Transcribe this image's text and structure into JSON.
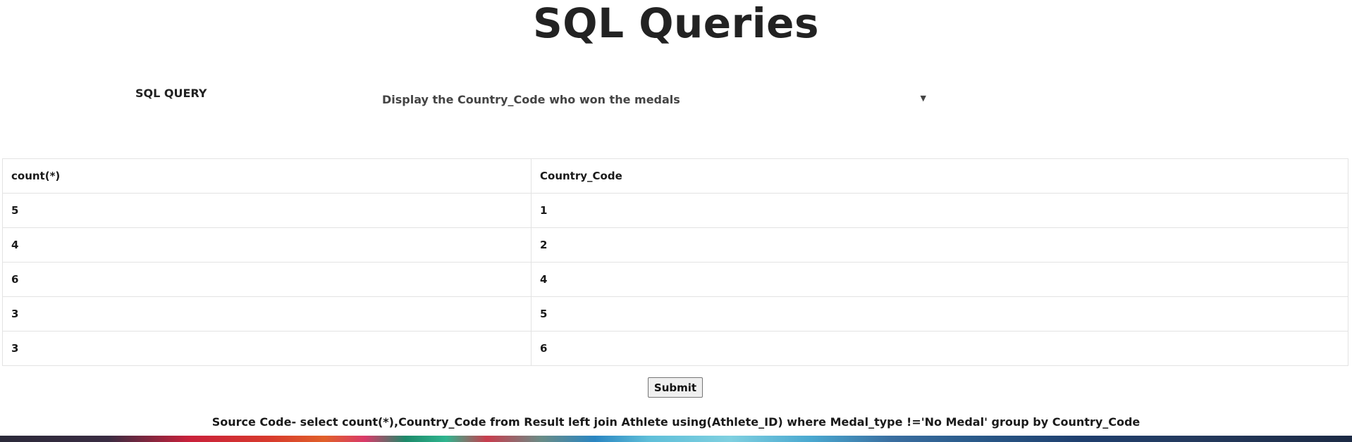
{
  "page": {
    "title": "SQL Queries"
  },
  "query": {
    "label": "SQL QUERY",
    "selected": "Display the Country_Code who won the medals"
  },
  "table": {
    "headers": [
      "count(*)",
      "Country_Code"
    ],
    "rows": [
      [
        "5",
        "1"
      ],
      [
        "4",
        "2"
      ],
      [
        "6",
        "4"
      ],
      [
        "3",
        "5"
      ],
      [
        "3",
        "6"
      ]
    ]
  },
  "actions": {
    "submit_label": "Submit"
  },
  "source": {
    "text": "Source Code- select count(*),Country_Code from Result left join Athlete using(Athlete_ID) where Medal_type !='No Medal' group by Country_Code"
  },
  "icons": {
    "dropdown": "chevron-down-icon"
  }
}
